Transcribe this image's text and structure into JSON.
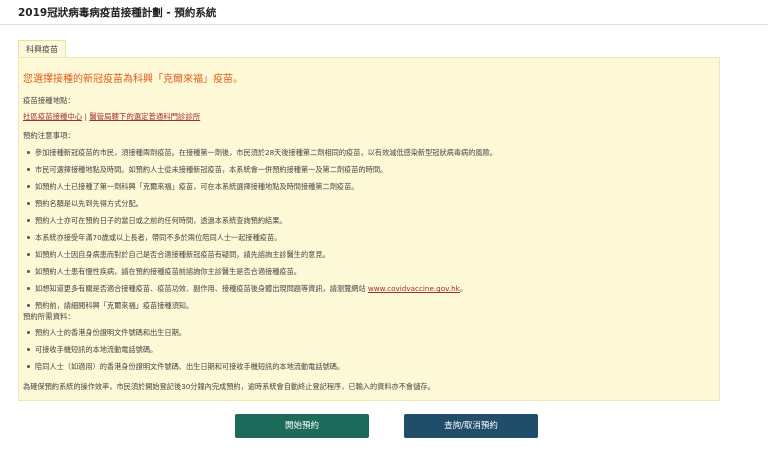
{
  "header": {
    "title": "2019冠狀病毒病疫苗接種計劃 - 預約系統"
  },
  "tab": {
    "label": "科興疫苗"
  },
  "panel": {
    "headline": "您選擇接種的新冠疫苗為科興「克爾來福」疫苗。",
    "venue_label": "疫苗接種地點：",
    "venue_links": [
      "社區疫苗接種中心",
      "醫管局轄下的選定普通科門診診所"
    ],
    "venue_separator": "|",
    "notes_label": "預約注意事項：",
    "notes": [
      "參加接種新冠疫苗的市民，須接種兩劑疫苗。在接種第一劑後，市民須於28天後接種第二劑相同的疫苗，以有效減低感染新型冠狀病毒病的風險。",
      "市民可選擇接種地點及時間。如預約人士從未接種新冠疫苗，本系統會一併預約接種第一及第二劑疫苗的時間。",
      "如預約人士已接種了第一劑科興「克爾來福」疫苗，可在本系統選擇接種地點及時間接種第二劑疫苗。",
      "預約名額是以先到先得方式分配。",
      "預約人士亦可在預約日子的當日或之前的任何時間，透過本系統查詢預約結果。",
      "本系統亦接受年滿70歲或以上長者，帶同不多於兩位陪同人士一起接種疫苗。",
      "如預約人士因自身病患而對於自己是否合適接種新冠疫苗有疑問，請先諮詢主診醫生的意見。",
      "如預約人士患有慢性疾病，請在預約接種疫苗前諮詢你主診醫生是否合適接種疫苗。",
      "如想知道更多有關是否適合接種疫苗、疫苗功效、副作用、接種疫苗後身體出現問題等資訊，請瀏覽網站 ",
      "預約前，請細閱科興「克爾來福」疫苗接種須知。"
    ],
    "notes_link": "www.covidvaccine.gov.hk",
    "notes_link_suffix": "。",
    "requirements_label": "預約所需資料：",
    "requirements": [
      "預約人士的香港身份證明文件號碼和出生日期。",
      "可接收手機短訊的本地流動電話號碼。",
      "陪同人士（如適用）的香港身份證明文件號碼、出生日期和可接收手機短訊的本地流動電話號碼。"
    ],
    "footer_note": "為確保預約系統的操作效率，市民須於開始登記後30分鐘內完成預約，逾時系統會自動終止登記程序，已輸入的資料亦不會儲存。"
  },
  "buttons": {
    "start": "開始預約",
    "query": "查詢/取消預約"
  },
  "colors": {
    "start_button": "#1c6b5a",
    "query_button": "#1f4d6a",
    "headline": "#e05e1c",
    "link": "#a0312d",
    "panel": "#fdf8d6"
  }
}
